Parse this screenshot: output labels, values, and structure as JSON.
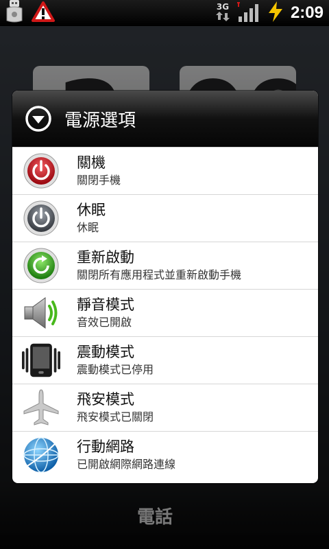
{
  "status_bar": {
    "time": "2:09",
    "network": "3G",
    "icons": [
      "usb-icon",
      "warning-icon",
      "3g-icon",
      "signal-icon",
      "battery-charging-icon"
    ]
  },
  "background": {
    "clock_digits": [
      "2",
      "09"
    ],
    "dock_label": "電話"
  },
  "dialog": {
    "title": "電源選項",
    "items": [
      {
        "title": "關機",
        "subtitle": "關閉手機",
        "icon": "power-off-icon"
      },
      {
        "title": "休眠",
        "subtitle": "休眠",
        "icon": "sleep-icon"
      },
      {
        "title": "重新啟動",
        "subtitle": "關閉所有應用程式並重新啟動手機",
        "icon": "restart-icon"
      },
      {
        "title": "靜音模式",
        "subtitle": "音效已開啟",
        "icon": "speaker-icon"
      },
      {
        "title": "震動模式",
        "subtitle": "震動模式已停用",
        "icon": "vibrate-icon"
      },
      {
        "title": "飛安模式",
        "subtitle": "飛安模式已關閉",
        "icon": "airplane-icon"
      },
      {
        "title": "行動網路",
        "subtitle": "已開啟網際網路連線",
        "icon": "globe-icon"
      }
    ]
  },
  "colors": {
    "power_off": "#c8101a",
    "restart": "#3aae20",
    "sleep": "#5a5f66",
    "globe": "#1f8ed8"
  }
}
